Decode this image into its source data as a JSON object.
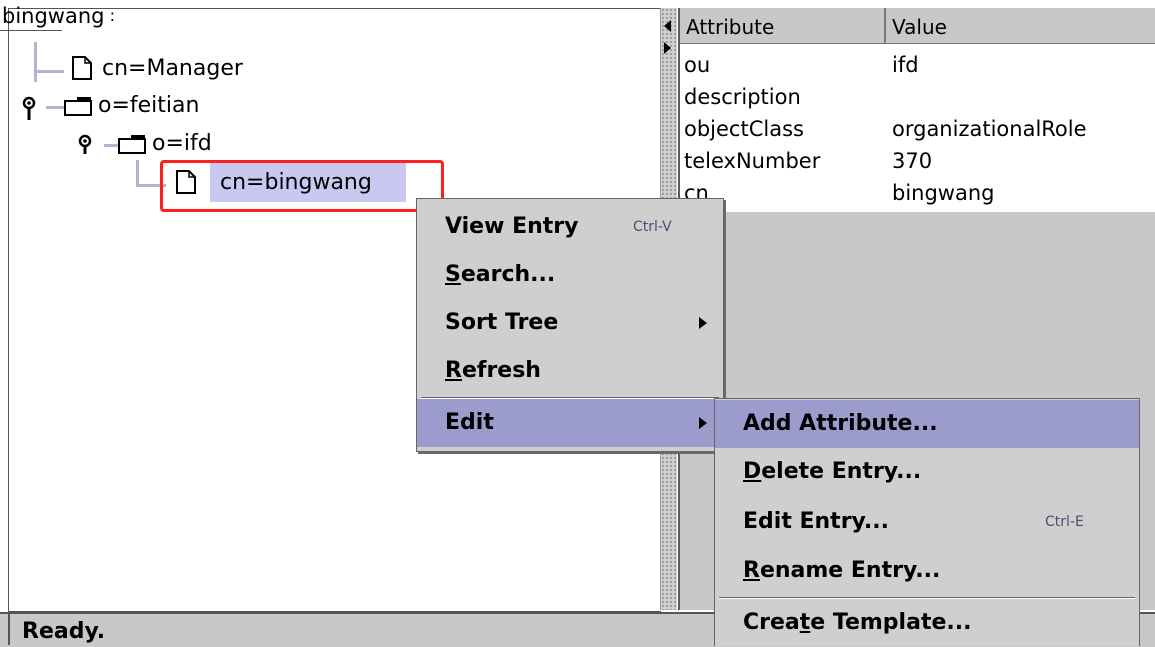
{
  "tree": {
    "root": "bingwang",
    "nodes": [
      {
        "label": "cn=Manager"
      },
      {
        "label": "o=feitian"
      },
      {
        "label": "o=ifd"
      },
      {
        "label": "cn=bingwang"
      }
    ]
  },
  "table": {
    "columns": [
      "Attribute",
      "Value"
    ],
    "rows": [
      {
        "attribute": "ou",
        "value": "ifd"
      },
      {
        "attribute": "description",
        "value": ""
      },
      {
        "attribute": "objectClass",
        "value": "organizationalRole"
      },
      {
        "attribute": "telexNumber",
        "value": "370"
      },
      {
        "attribute": "cn",
        "value": "bingwang"
      }
    ]
  },
  "context_menu": {
    "items": [
      {
        "label": "View Entry",
        "shortcut": "Ctrl-V"
      },
      {
        "label": "Search...",
        "mnemonic": "S"
      },
      {
        "label": "Sort Tree",
        "submenu": true
      },
      {
        "label": "Refresh",
        "mnemonic": "R"
      },
      {
        "label": "Edit",
        "submenu": true,
        "active": true
      }
    ]
  },
  "edit_submenu": {
    "items": [
      {
        "label": "Add Attribute...",
        "active": true
      },
      {
        "label": "Delete Entry...",
        "mnemonic": "D"
      },
      {
        "label": "Edit Entry...",
        "shortcut": "Ctrl-E"
      },
      {
        "label": "Rename Entry...",
        "mnemonic": "R"
      },
      {
        "label": "Create Template...",
        "mnemonic": "t"
      }
    ]
  },
  "status": "Ready.",
  "colors": {
    "selection": "#c8c8f0",
    "menu_active": "#9c9ccc",
    "menu_bg": "#cfcfcf",
    "highlight_box": "#ff1e1e",
    "tree_lines": "#b4b4d2"
  }
}
